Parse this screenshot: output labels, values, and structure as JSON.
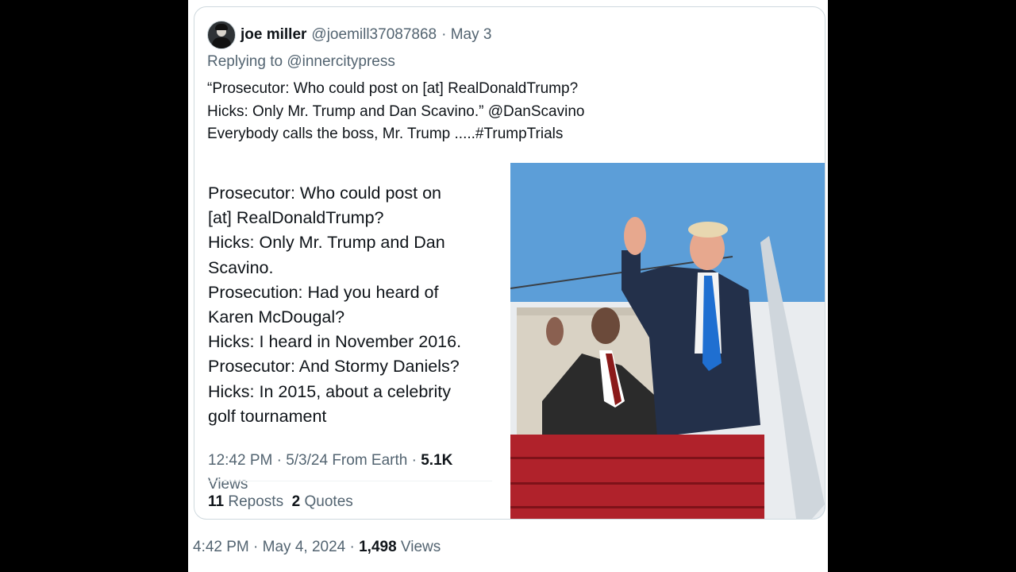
{
  "tweet": {
    "author_name": "joe miller",
    "author_handle": "@joemill37087868",
    "date": "· May 3",
    "replying_prefix": "Replying to ",
    "replying_handle": "@innercitypress",
    "lines": [
      "“Prosecutor: Who could post on [at] RealDonaldTrump?",
      "Hicks: Only Mr. Trump and Dan Scavino.” @DanScavino",
      "Everybody calls the boss, Mr. Trump .....#TrumpTrials"
    ]
  },
  "embedded": {
    "lines": [
      "Prosecutor: Who could post on",
      "[at] RealDonaldTrump?",
      "Hicks: Only Mr. Trump and Dan",
      "Scavino.",
      "Prosecution: Had you heard of",
      "Karen McDougal?",
      "Hicks: I heard in November 2016.",
      "Prosecutor: And Stormy Daniels?",
      "Hicks: In 2015, about a celebrity",
      "golf tournament"
    ],
    "time": "12:42 PM · 5/3/24 From Earth · ",
    "views_count": "5.1K",
    "views_label": "Views",
    "reposts_count": "11",
    "reposts_label": "Reposts",
    "quotes_count": "2",
    "quotes_label": "Quotes"
  },
  "footer": {
    "time": "4:42 PM · May 4, 2024 · ",
    "views_count": "1,498",
    "views_label": "Views"
  },
  "colors": {
    "background": "#000000",
    "text_primary": "#0f1419",
    "text_secondary": "#536471",
    "border": "#cfd9de"
  }
}
